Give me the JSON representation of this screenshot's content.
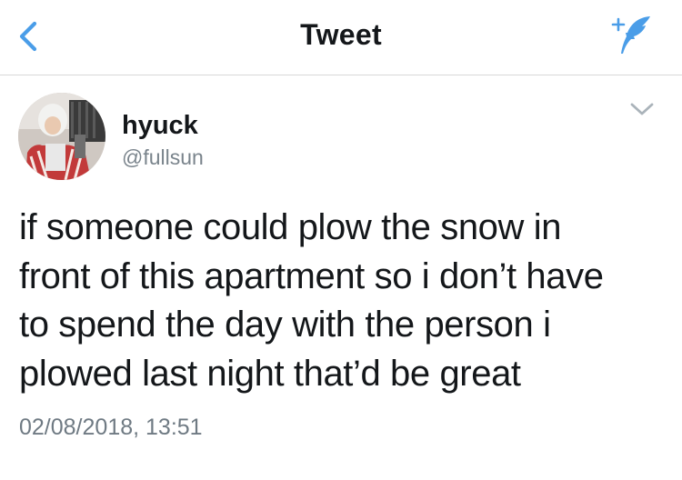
{
  "header": {
    "title": "Tweet",
    "back_icon": "chevron-left-icon",
    "compose_icon": "feather-plus-icon",
    "accent_color": "#4a9de8"
  },
  "tweet": {
    "display_name": "hyuck",
    "handle": "@fullsun",
    "lines": [
      "if someone could plow the snow in",
      "front of this apartment so i don’t have",
      "to spend the day with the person i",
      "plowed last night that’d be great"
    ],
    "timestamp": "02/08/2018, 13:51"
  },
  "colors": {
    "text": "#14171a",
    "secondary": "#7a848c",
    "divider": "#d7d7d7"
  }
}
